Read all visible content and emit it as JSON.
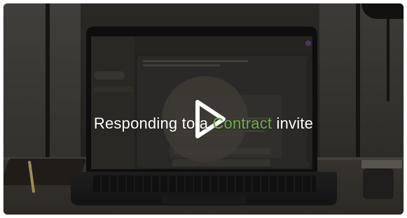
{
  "video": {
    "caption_before": "Respondin",
    "caption_mid1": "g to a ",
    "caption_highlight": "Contract",
    "caption_after": " invite",
    "highlight_color": "#6ab04c",
    "play_icon": "play-icon"
  }
}
